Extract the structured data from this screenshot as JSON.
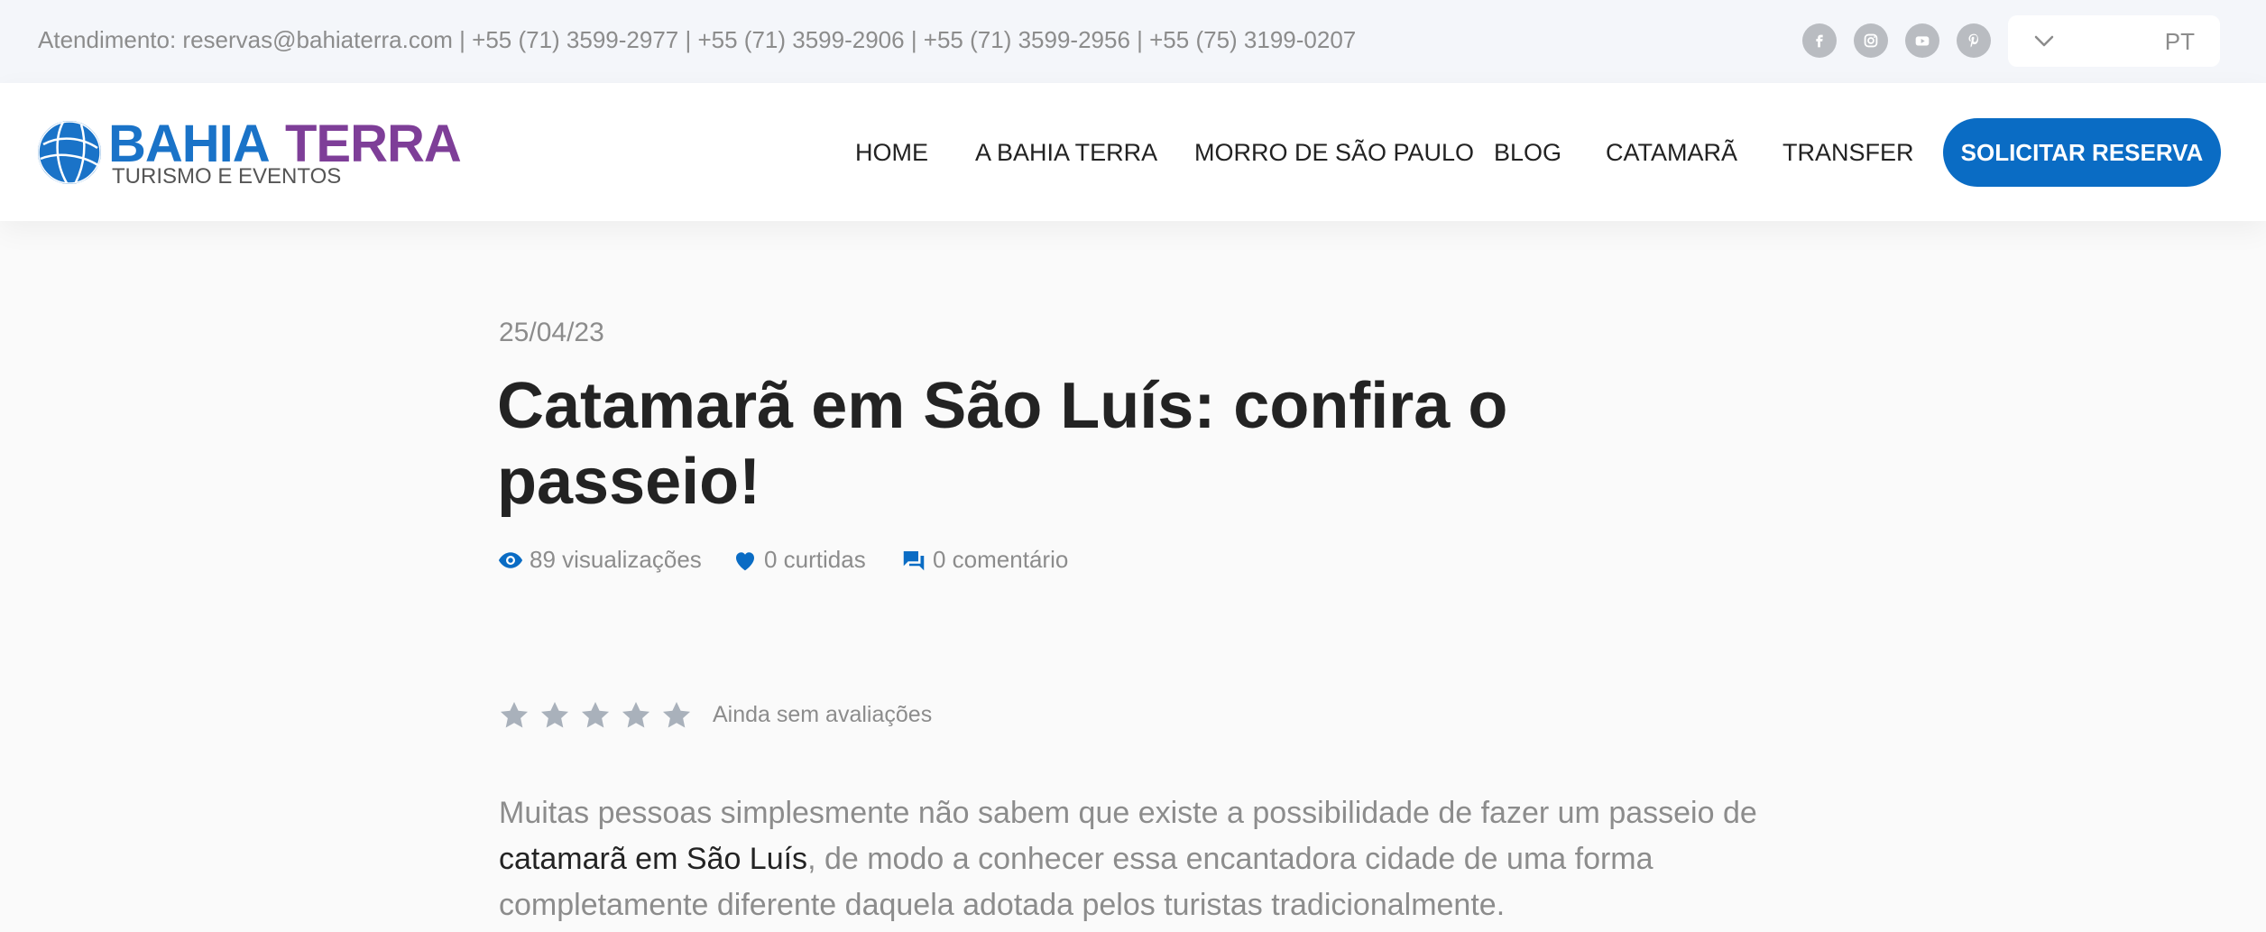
{
  "topbar": {
    "contact": "Atendimento: reservas@bahiaterra.com | +55 (71) 3599-2977 | +55 (71) 3599-2906 | +55 (71) 3599-2956 | +55 (75)  3199-0207",
    "social": [
      "facebook-icon",
      "instagram-icon",
      "youtube-icon",
      "pinterest-icon"
    ],
    "language": "PT"
  },
  "header": {
    "logo": {
      "brand_1": "BAHIA",
      "brand_2": "TERRA",
      "tagline": "TURISMO E EVENTOS"
    },
    "nav": [
      "HOME",
      "A BAHIA TERRA",
      "MORRO DE SÃO PAULO",
      "BLOG",
      "CATAMARÃ",
      "TRANSFER"
    ],
    "cta": "SOLICITAR RESERVA"
  },
  "post": {
    "date": "25/04/23",
    "title": "Catamarã em São Luís: confira o passeio!",
    "meta": {
      "views": "89 visualizações",
      "likes": "0 curtidas",
      "comments": "0 comentário"
    },
    "rating": {
      "stars": 0,
      "max": 5,
      "text": "Ainda sem avaliações"
    },
    "intro": {
      "before": "Muitas pessoas simplesmente não sabem que existe a possibilidade de fazer um passeio de ",
      "highlight": "catamarã em São Luís",
      "after": ", de modo a conhecer essa encantadora cidade de uma forma completamente diferente daquela adotada pelos turistas tradicionalmente."
    }
  },
  "colors": {
    "brand_blue": "#0a6cc4",
    "brand_purple": "#7e3e98",
    "topbar_bg": "#f4f6fa",
    "muted_text": "#8c8c8c",
    "star_empty": "#a9b1bb"
  }
}
